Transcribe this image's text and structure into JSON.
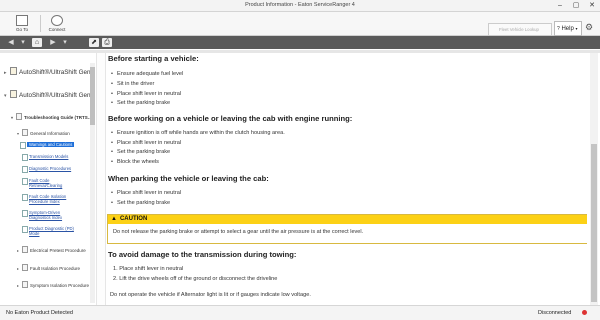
{
  "window": {
    "title": "Product Information - Eaton ServiceRanger 4"
  },
  "ribbon": {
    "go_to_label": "Go To",
    "connect_label": "Connect",
    "lookup_placeholder": "Fleet Vehicle Lookup",
    "help_label": "Help"
  },
  "tree": {
    "top_items": [
      "AutoShift®/UltraShift Gen2",
      "AutoShift®/UltraShift Gen3"
    ],
    "troubleshooting": "Troubleshooting Guide (TRTS…",
    "general_information": "General Information",
    "docs": [
      [
        "Warnings and Cautions"
      ],
      [
        "Transmission Models"
      ],
      [
        "Diagnostic Procedures"
      ],
      [
        "Fault Code",
        "Retrieval/Clearing"
      ],
      [
        "Fault Code Isolation",
        "Procedure Index"
      ],
      [
        "Symptom-Driven",
        "Diagnostics Index"
      ],
      [
        "Product Diagnostic (PD)",
        "Mode"
      ]
    ],
    "sections": [
      "Electrical Pretest Procedure",
      "Fault Isolation Procedure",
      "Symptom Isolation Procedure"
    ]
  },
  "content": {
    "section1_title": "Before starting a vehicle:",
    "section1_items": [
      "Ensure adequate fuel level",
      "Sit in the driver",
      "Place shift lever in neutral",
      "Set the parking brake"
    ],
    "section2_title": "Before working on a vehicle or leaving the cab with engine running:",
    "section2_items": [
      "Ensure ignition is off while hands are within the clutch housing area.",
      "Place shift lever in neutral",
      "Set the parking brake",
      "Block the wheels"
    ],
    "section3_title": "When parking the vehicle or leaving the cab:",
    "section3_items": [
      "Place shift lever in neutral",
      "Set the parking brake"
    ],
    "caution_title": "CAUTION",
    "caution_text": "Do not release the parking brake or attempt to select a gear until the air pressure is at the correct level.",
    "section4_title": "To avoid damage to the transmission during towing:",
    "section4_items": [
      "1. Place shift lever in neutral",
      "2. Lift the drive wheels off of the ground or disconnect the driveline"
    ],
    "final_note": "Do not operate the vehicle if Alternator light is lit or if gauges indicate low voltage."
  },
  "status": {
    "left": "No Eaton Product Detected",
    "right": "Disconnected"
  },
  "colors": {
    "selected": "#1e6fd9",
    "caution_header": "#fcd116",
    "link": "#2a53a5",
    "toolbar": "#5a5a5a"
  }
}
